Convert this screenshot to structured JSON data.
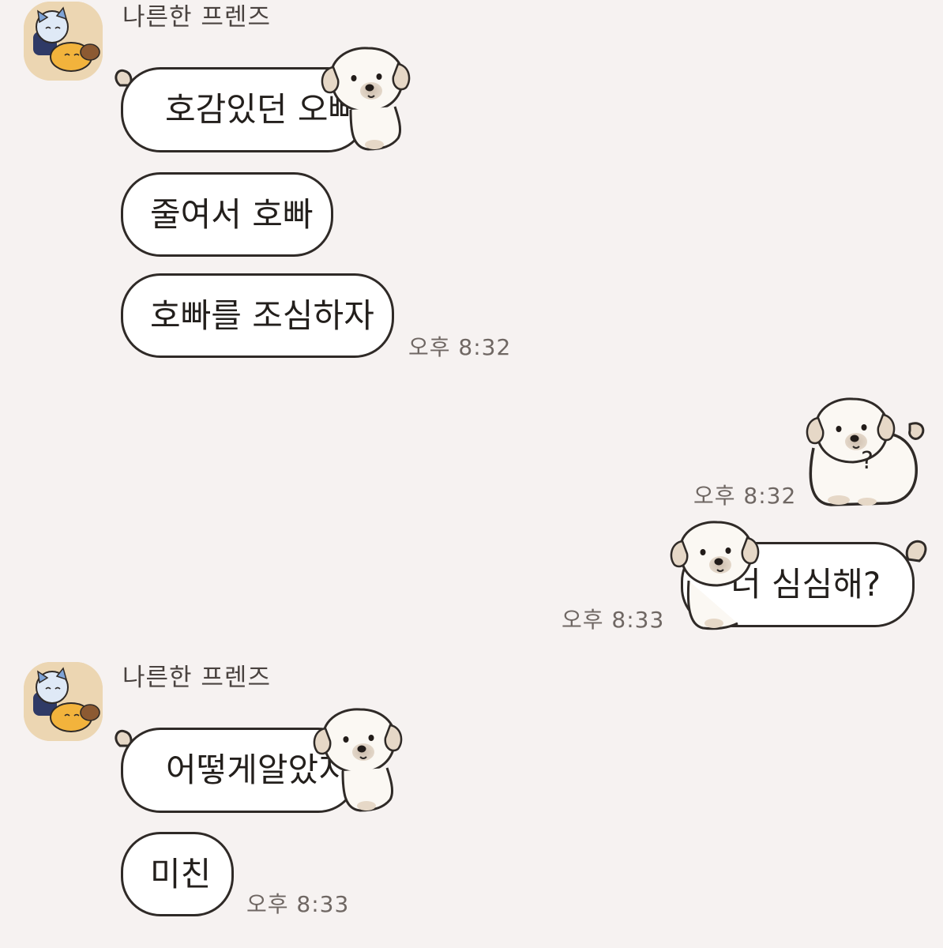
{
  "colors": {
    "background": "#f6f2f1",
    "bubble_fill": "#ffffff",
    "bubble_outline": "#2f2a27",
    "time_text": "#6f6763"
  },
  "groups": [
    {
      "sender": "나른한 프렌즈",
      "avatar_icon": "friends-character-avatar",
      "messages": [
        "호감있던 오빠",
        "줄여서 호빠",
        "호빠를 조심하자"
      ],
      "time": "오후 8:32"
    },
    {
      "side": "me",
      "sticker_text": "?",
      "sticker_icon": "puppy-question-sticker",
      "time": "오후 8:32"
    },
    {
      "side": "me",
      "messages": [
        "너 심심해?"
      ],
      "time": "오후 8:33"
    },
    {
      "sender": "나른한 프렌즈",
      "avatar_icon": "friends-character-avatar",
      "messages": [
        "어떻게알았지",
        "미친"
      ],
      "time": "오후 8:33"
    }
  ]
}
